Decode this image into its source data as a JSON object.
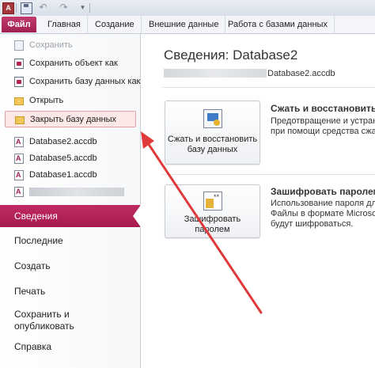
{
  "quick_access": {
    "app_icon_letter": "A",
    "icons": [
      "save-icon",
      "undo-icon",
      "redo-icon",
      "customize-icon"
    ]
  },
  "ribbon": {
    "tabs": [
      "Файл",
      "Главная",
      "Создание",
      "Внешние данные",
      "Работа с базами данных"
    ]
  },
  "backstage": {
    "commands": [
      {
        "label": "Сохранить",
        "icon": "save-icon",
        "disabled": true
      },
      {
        "label": "Сохранить объект как",
        "icon": "database-icon"
      },
      {
        "label": "Сохранить базу данных как",
        "icon": "database-icon"
      },
      {
        "label": "Открыть",
        "icon": "folder-icon"
      },
      {
        "label": "Закрыть базу данных",
        "icon": "folder-icon",
        "highlighted": true
      }
    ],
    "recent_files": [
      "Database2.accdb",
      "Database5.accdb",
      "Database1.accdb"
    ],
    "nav": [
      "Сведения",
      "Последние",
      "Создать",
      "Печать",
      "Сохранить и опубликовать",
      "Справка"
    ],
    "nav_save_line1": "Сохранить и",
    "nav_save_line2": "опубликовать",
    "active_nav": "Сведения"
  },
  "info": {
    "title": "Сведения: Database2",
    "path_filename": "Database2.accdb",
    "compact": {
      "button_line1": "Сжать и восстановить",
      "button_line2": "базу данных",
      "heading": "Сжать и восстановить",
      "desc_line1": "Предотвращение и устранен",
      "desc_line2": "при помощи средства сжати"
    },
    "encrypt": {
      "button_line1": "Зашифровать",
      "button_line2": "паролем",
      "heading": "Зашифровать паролем",
      "desc_line1": "Использование пароля для",
      "desc_line2": "Файлы в формате Microsoft",
      "desc_line3": "будут шифроваться."
    }
  },
  "colors": {
    "accent": "#b3245a",
    "arrow": "#e03a3a"
  }
}
